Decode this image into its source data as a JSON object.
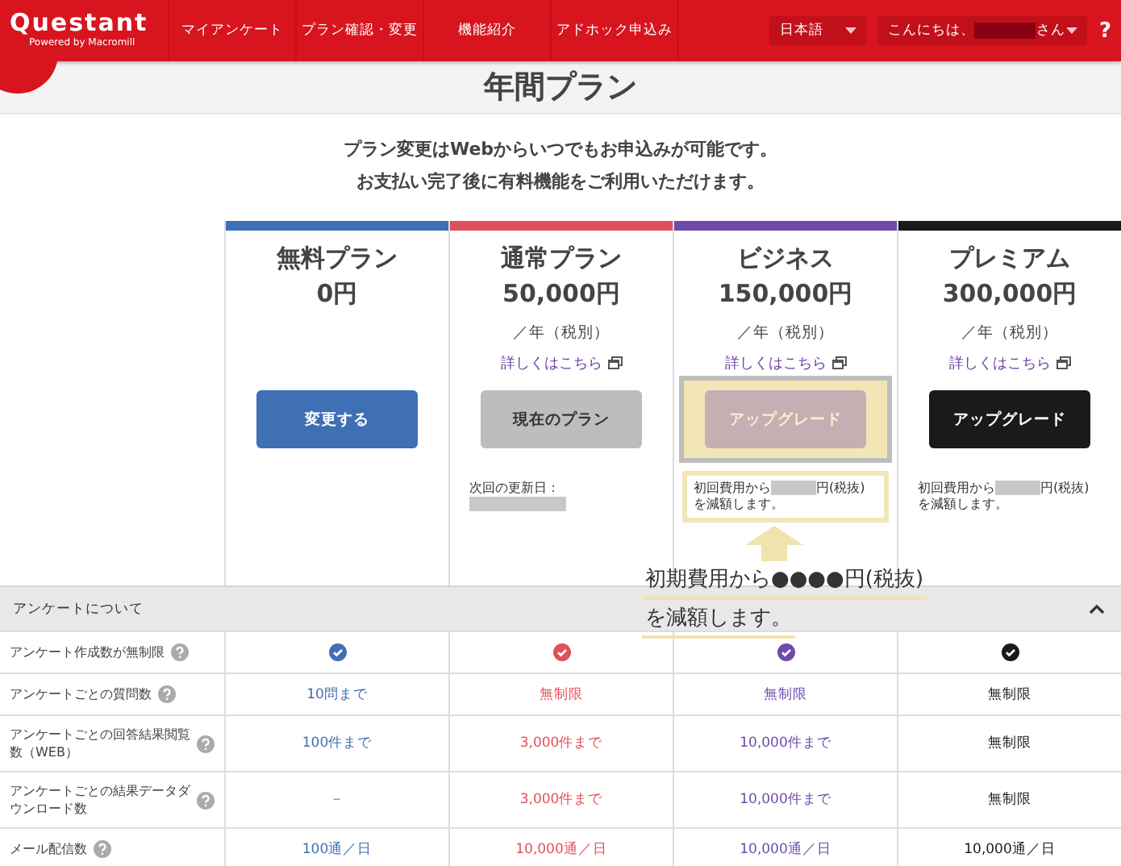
{
  "header": {
    "logo": "Questant",
    "tagline": "Powered by Macromill",
    "nav": [
      {
        "label": "マイアンケート"
      },
      {
        "label": "プラン確認・変更"
      },
      {
        "label": "機能紹介"
      },
      {
        "label": "アドホック申込み"
      }
    ],
    "language": "日本語",
    "greeting_before": "こんにちは、",
    "greeting_after": "さん",
    "help": "?"
  },
  "title": "年間プラン",
  "intro": [
    "プラン変更はWebからいつでもお申込みが可能です。",
    "お支払い完了後に有料機能をご利用いただけます。"
  ],
  "plans": [
    {
      "name": "無料プラン",
      "price": "0円",
      "color": "#3f6fb5",
      "button": "変更する",
      "current": false,
      "highlighted": false
    },
    {
      "name": "通常プラン",
      "price": "50,000円",
      "unit": "／年（税別）",
      "link": "詳しくはこちら",
      "color": "#e0505a",
      "button": "現在のプラン",
      "current": true,
      "highlighted": false,
      "note": [
        {
          "kind": "text",
          "text": "次回の更新日："
        },
        {
          "kind": "redacted"
        }
      ]
    },
    {
      "name": "ビジネス",
      "price": "150,000円",
      "unit": "／年（税別）",
      "link": "詳しくはこちら",
      "color": "#6e4bab",
      "button": "アップグレード",
      "current": false,
      "highlighted": true,
      "note": [
        {
          "kind": "text",
          "text": "初回費用から"
        },
        {
          "kind": "redacted"
        },
        {
          "kind": "text",
          "text": "円(税抜)"
        },
        {
          "kind": "text",
          "text": "を減額します。"
        }
      ]
    },
    {
      "name": "プレミアム",
      "price": "300,000円",
      "unit": "／年（税別）",
      "link": "詳しくはこちら",
      "color": "#1a1a1a",
      "button": "アップグレード",
      "current": false,
      "highlighted": false,
      "note": [
        {
          "kind": "text",
          "text": "初回費用から"
        },
        {
          "kind": "redacted"
        },
        {
          "kind": "text",
          "text": "円(税抜)"
        },
        {
          "kind": "text",
          "text": "を減額します。"
        }
      ]
    }
  ],
  "section": {
    "title": "アンケートについて",
    "expanded": true
  },
  "rows": [
    {
      "label": "アンケート作成数が無制限",
      "kind": "check"
    },
    {
      "label": "アンケートごとの質問数",
      "kind": "text",
      "values": [
        "10問まで",
        "無制限",
        "無制限",
        "無制限"
      ]
    },
    {
      "label": "アンケートごとの回答結果閲覧数（WEB）",
      "kind": "text",
      "values": [
        "100件まで",
        "3,000件まで",
        "10,000件まで",
        "無制限"
      ]
    },
    {
      "label": "アンケートごとの結果データダウンロード数",
      "kind": "text",
      "values": [
        "－",
        "3,000件まで",
        "10,000件まで",
        "無制限"
      ]
    },
    {
      "label": "メール配信数",
      "kind": "text",
      "values": [
        "100通／日",
        "10,000通／日",
        "10,000通／日",
        "10,000通／日"
      ]
    }
  ],
  "callout": {
    "lines": [
      "初期費用から●●●●円(税抜)",
      "を減額します。"
    ]
  }
}
